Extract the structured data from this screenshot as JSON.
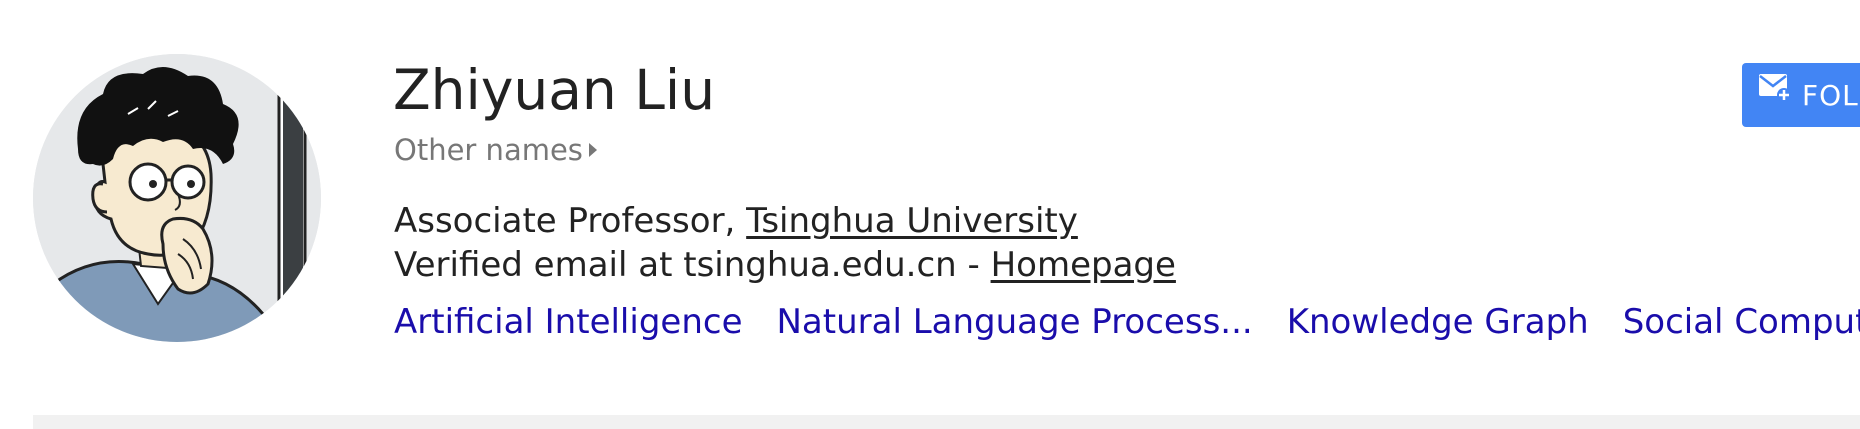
{
  "profile": {
    "name": "Zhiyuan Liu",
    "other_names_label": "Other names",
    "position_prefix": "Associate Professor, ",
    "affiliation_link": "Tsinghua University",
    "email_prefix": "Verified email at tsinghua.edu.cn - ",
    "homepage_link": "Homepage",
    "interests": [
      {
        "label": "Artificial Intelligence"
      },
      {
        "label": "Natural Language Process..."
      },
      {
        "label": "Knowledge Graph"
      },
      {
        "label": "Social Computing"
      }
    ]
  },
  "follow_button": {
    "label": "FOLLOW",
    "icon": "email-plus-icon"
  },
  "colors": {
    "link_blue": "#1a0dab",
    "follow_blue": "#4285f4",
    "text_dark": "#222222",
    "text_muted": "#777777"
  }
}
